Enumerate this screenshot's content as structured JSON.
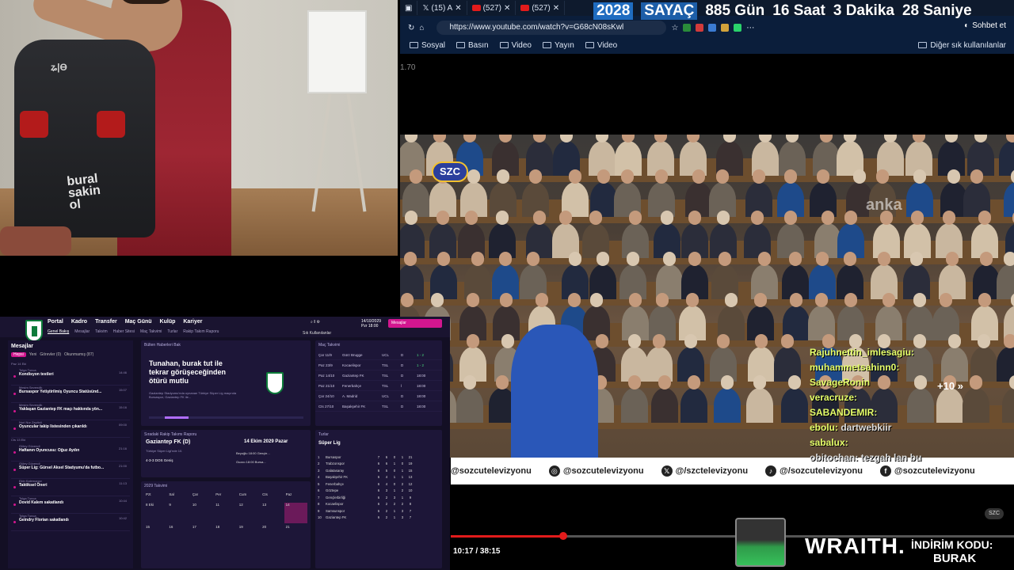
{
  "browser": {
    "tabs": [
      {
        "label": "",
        "icon": "window-icon"
      },
      {
        "label": "(15) A",
        "icon": "x-icon"
      },
      {
        "label": "(527)",
        "icon": "youtube-icon"
      },
      {
        "label": "(527)",
        "icon": "youtube-icon"
      }
    ],
    "url": "https://www.youtube.com/watch?v=G68cN08sKwl",
    "chat_button": "Sohbet et",
    "bookmarks": [
      "Sosyal",
      "Basın",
      "Video",
      "Yayın",
      "Video"
    ],
    "other_bookmarks": "Diğer sık kullanılanlar"
  },
  "counter": {
    "year": "2028",
    "label": "SAYAÇ",
    "days": "885 Gün",
    "hours": "16 Saat",
    "minutes": "3 Dakika",
    "seconds": "28 Saniye"
  },
  "video": {
    "speed": "1.70",
    "channel_logo": "SZC",
    "watermark": "anka",
    "skip": "+10",
    "social": [
      "@sozcutelevizyonu",
      "@sozcutelevizyonu",
      "@/szctelevizyonu",
      "@/sozcutelevizyonu",
      "@sozcutelevizyonu"
    ],
    "time": "10:17 / 38:15",
    "progress": 0.2,
    "small_logo": "SZC"
  },
  "chat": [
    {
      "user": "Rajuhnettin_imlesagiu:",
      "msg": ""
    },
    {
      "user": "muhammetsahinn0:",
      "msg": ""
    },
    {
      "user": "SavageRonin",
      "msg": ""
    },
    {
      "user": "veracruze:",
      "msg": ""
    },
    {
      "user": "SABANDEMIR:",
      "msg": ""
    },
    {
      "user": "ebolu:",
      "msg": "dartwebkiir"
    },
    {
      "user": "sabalux:",
      "msg": ""
    },
    {
      "user": "obitochan:",
      "msg": "tezgah lan bu"
    }
  ],
  "sponsor": {
    "brand": "WRAITH.",
    "promo_label": "İNDİRİM KODU:",
    "promo_code": "BURAK"
  },
  "game": {
    "nav": [
      "Portal",
      "Kadro",
      "Transfer",
      "Maç Günü",
      "Kulüp",
      "Kariyer"
    ],
    "subnav": [
      "Genel Bakış",
      "Mesajlar",
      "Takvim",
      "Haber Sitesi",
      "Maç Takvimi",
      "Turlar",
      "Rakip Takım Raporu"
    ],
    "date": "14/10/2029",
    "date_day": "Pzr 18:00",
    "messages_button": "Mesajlar",
    "manager": "Sık Kullanılanlar",
    "inbox_title": "Mesajlar",
    "inbox_filters": [
      "Hepsi",
      "Yeni",
      "Görevler (0)",
      "Okunmamış (87)"
    ],
    "inbox": [
      {
        "section": "Paz 14 Eki",
        "from": "Tolga Tunca",
        "subject": "Kondisyon testleri",
        "time": "14:46"
      },
      {
        "section": "",
        "from": "Mesim Sevendik",
        "subject": "Bursaspor Yetiştirilmiş Oyuncu Statüsünd...",
        "time": "15:07"
      },
      {
        "section": "",
        "from": "Mesim Sevendik",
        "subject": "Yaklaşan Gaziantep FK maçı hakkında yön...",
        "time": "15:16"
      },
      {
        "section": "",
        "from": "Nuri Nur Zeytinli",
        "subject": "Oyuncular takip listesinden çıkarıldı",
        "time": "09:00"
      },
      {
        "section": "Cts 13 Eki",
        "from": "Güley Güvendi",
        "subject": "Haftanın Oyuncusu: Oğuz Aydın",
        "time": "21:16"
      },
      {
        "section": "",
        "from": "Güley Güvendi",
        "subject": "Süper Lig: Gürsel Aksel Stadyumu'da futbo...",
        "time": "21:00"
      },
      {
        "section": "",
        "from": "Ekin Kalemanov",
        "subject": "Taktiksel Öneri",
        "time": "11:13"
      },
      {
        "section": "",
        "from": "Tolga Tunca",
        "subject": "Dovid Kalem sakatlandı",
        "time": "10:44"
      },
      {
        "section": "",
        "from": "Tolga Tunca",
        "subject": "Geindry Florian sakatlandı",
        "time": "10:42"
      }
    ],
    "news_title": "Bülten Haberleri Bak",
    "news_headline": "Tunahan, burak tut ile tekrar görüşeceğinden ötürü mutlu",
    "news_body": "Gaziantep Stadyumu'nda oynanan Türkiye Süper Lig maçında Bursaspor, Gaziantep FK ile...",
    "fixtures_title": "Maç Takvimi",
    "fixtures": [
      [
        "Çar 11/9",
        "Gürz Brugge",
        "UCL",
        "D",
        "1 - 2"
      ],
      [
        "Paz 23/9",
        "Kocaelispor",
        "TSL",
        "D",
        "1 - 2"
      ],
      [
        "Paz 14/10",
        "Gaziantep FK",
        "TSL",
        "D",
        "18:00"
      ],
      [
        "Paz 21/10",
        "Fenerbahçe",
        "TSL",
        "İ",
        "18:00"
      ],
      [
        "Çar 24/10",
        "A. Madrid",
        "UCL",
        "D",
        "18:00"
      ],
      [
        "Cts 27/10",
        "Başakşehir FK",
        "TSL",
        "D",
        "18:00"
      ]
    ],
    "next_title": "Sıradaki Rakip Takımı Raporu",
    "next_team": "Gaziantep FK (D)",
    "next_sub": "Türkiye Süper Ligi'nde 10.",
    "next_tactic": "4-3-3 DOS Geniş",
    "next_date": "14 Ekim 2029 Pazar",
    "next_list": [
      "Beyoğlu 18:00 Gençle...",
      "Guzzo 18:00 Bursa..."
    ],
    "calendar_title": "2029 Takvimi",
    "calendar_head": [
      "Pzt",
      "Sal",
      "Çar",
      "Per",
      "Cum",
      "Cts",
      "Paz"
    ],
    "calendar_days": [
      "8 Eki",
      "9",
      "10",
      "11",
      "12",
      "13",
      "14",
      "15",
      "16",
      "17",
      "18",
      "19",
      "20",
      "21"
    ],
    "table_title": "Turlar",
    "table_league": "Süper Lig",
    "table": [
      [
        "1",
        "Bursaspor",
        "7",
        "6",
        "0",
        "1",
        "21"
      ],
      [
        "2",
        "Trabzonspor",
        "6",
        "6",
        "1",
        "0",
        "19"
      ],
      [
        "3",
        "Galatasaray",
        "6",
        "5",
        "0",
        "1",
        "15"
      ],
      [
        "4",
        "Başakşehir FK",
        "6",
        "4",
        "1",
        "1",
        "13"
      ],
      [
        "5",
        "Fenerbahçe",
        "6",
        "4",
        "0",
        "2",
        "12"
      ],
      [
        "6",
        "Göztepe",
        "6",
        "3",
        "1",
        "2",
        "10"
      ],
      [
        "7",
        "Gençlerbirliği",
        "6",
        "2",
        "3",
        "1",
        "9"
      ],
      [
        "8",
        "Kocaelispor",
        "6",
        "2",
        "2",
        "2",
        "8"
      ],
      [
        "9",
        "Samsunspor",
        "6",
        "2",
        "1",
        "3",
        "7"
      ],
      [
        "10",
        "Gaziantep FK",
        "6",
        "2",
        "1",
        "3",
        "7"
      ]
    ]
  }
}
